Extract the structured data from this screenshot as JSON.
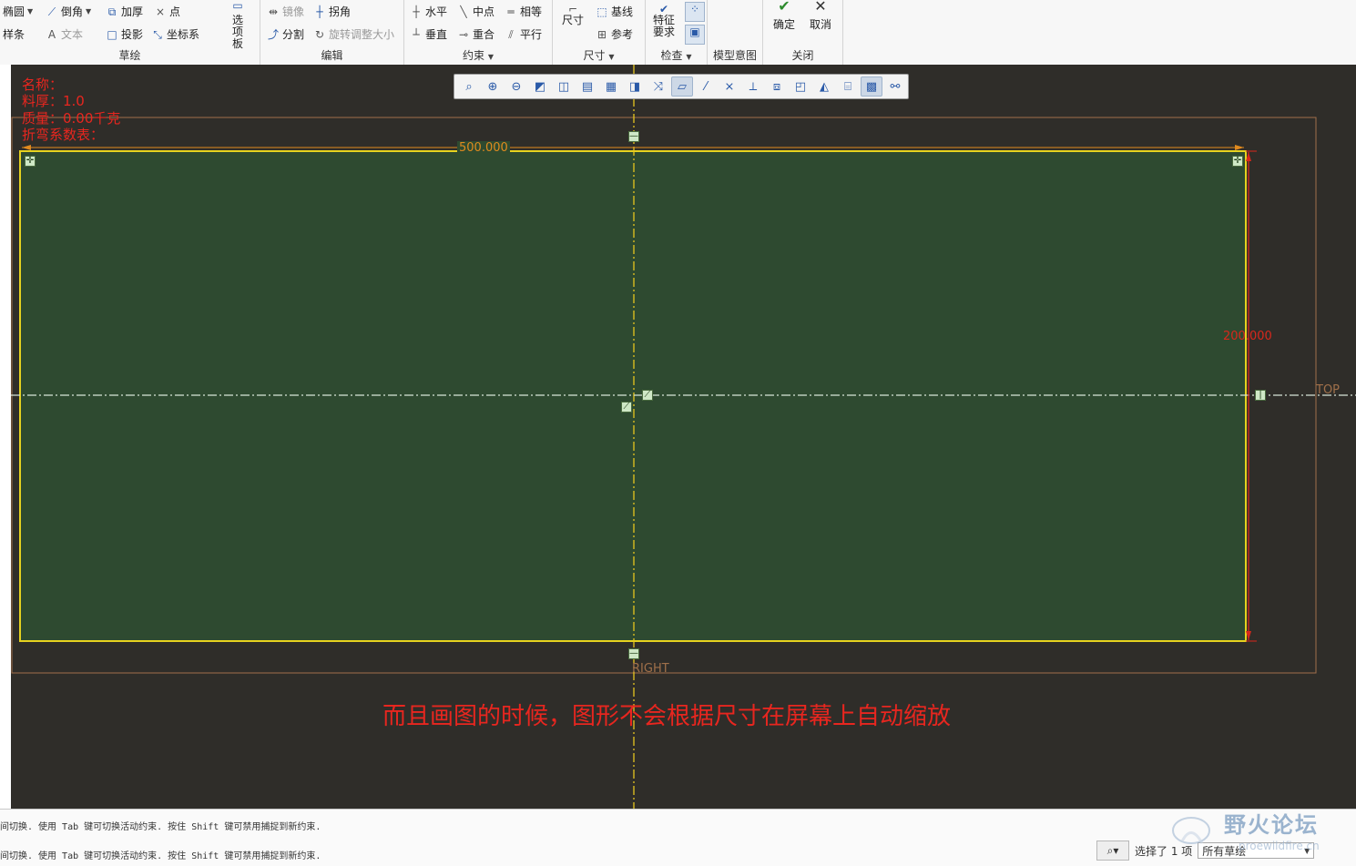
{
  "ribbon": {
    "sketch": {
      "label": "草绘",
      "ellipse": "椭圆",
      "chamfer": "倒角",
      "thicken": "加厚",
      "point": "点",
      "spline": "样条",
      "text": "文本",
      "project": "投影",
      "coordsys": "坐标系",
      "palette": "选项板"
    },
    "edit": {
      "label": "编辑",
      "mirror": "镜像",
      "corner": "拐角",
      "divide": "分割",
      "rotate_resize": "旋转调整大小"
    },
    "constrain": {
      "label": "约束",
      "horizontal": "水平",
      "midpoint": "中点",
      "equal": "相等",
      "vertical": "垂直",
      "coincident": "重合",
      "parallel": "平行"
    },
    "dimension": {
      "label": "尺寸",
      "dimension": "尺寸",
      "baseline": "基线",
      "reference": "参考"
    },
    "inspect": {
      "label": "检查",
      "feature_req": "特征要求"
    },
    "model_intent": {
      "label": "模型意图"
    },
    "close": {
      "label": "关闭",
      "ok": "确定",
      "cancel": "取消"
    }
  },
  "sheet_info": {
    "name": "名称：",
    "thickness": "料厚：1.0",
    "mass": "质量：0.00千克",
    "bend_table": "折弯系数表："
  },
  "sketch": {
    "width_dim": "500.000",
    "height_dim": "200.000",
    "plane_top": "TOP",
    "plane_right": "RIGHT"
  },
  "annotation": "而且画图的时候，图形不会根据尺寸在屏幕上自动缩放",
  "status": {
    "msg1": "间切换. 使用 Tab 键可切换活动约束. 按住 Shift 键可禁用捕捉到新约束.",
    "msg2": "间切换. 使用 Tab 键可切换活动约束. 按住 Shift 键可禁用捕捉到新约束.",
    "selected": "选择了 1 项",
    "filter": "所有草绘"
  },
  "watermark": {
    "title": "野火论坛",
    "url": "proewildfire.cn"
  },
  "colors": {
    "canvas": "#2f2d29",
    "sketch_fill": "#2e4a30",
    "sketch_edge": "#e6d21f",
    "centerline": "#e6c61f",
    "dim_orange": "#e08a1e",
    "dim_red": "#d8281c",
    "annotation": "#e8261f"
  }
}
